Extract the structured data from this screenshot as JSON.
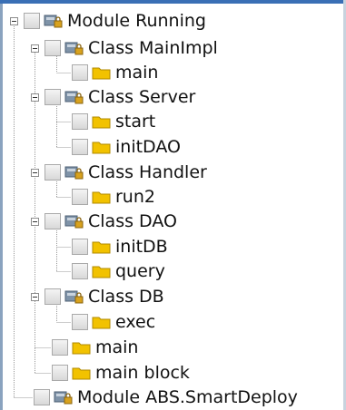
{
  "tree": {
    "modules": [
      {
        "label": "Module Running",
        "icon": "module-icon",
        "children": [
          {
            "label": "Class MainImpl",
            "icon": "class-icon",
            "children": [
              {
                "label": "main",
                "icon": "folder-icon"
              }
            ]
          },
          {
            "label": "Class Server",
            "icon": "class-icon",
            "children": [
              {
                "label": "start",
                "icon": "folder-icon"
              },
              {
                "label": "initDAO",
                "icon": "folder-icon"
              }
            ]
          },
          {
            "label": "Class Handler",
            "icon": "class-icon",
            "children": [
              {
                "label": "run2",
                "icon": "folder-icon"
              }
            ]
          },
          {
            "label": "Class DAO",
            "icon": "class-icon",
            "children": [
              {
                "label": "initDB",
                "icon": "folder-icon"
              },
              {
                "label": "query",
                "icon": "folder-icon"
              }
            ]
          },
          {
            "label": "Class DB",
            "icon": "class-icon",
            "children": [
              {
                "label": "exec",
                "icon": "folder-icon"
              }
            ]
          },
          {
            "label": "main",
            "icon": "folder-icon"
          },
          {
            "label": "main block",
            "icon": "folder-icon"
          }
        ]
      },
      {
        "label": "Module ABS.SmartDeploy",
        "icon": "module-icon"
      }
    ]
  },
  "colors": {
    "folder": "#f2c200",
    "folder_outline": "#b08a00",
    "class_box": "#7f93a8",
    "module_lock": "#d8a21e",
    "tree_line": "#9a9a9a",
    "accent": "#3a6fb5"
  }
}
